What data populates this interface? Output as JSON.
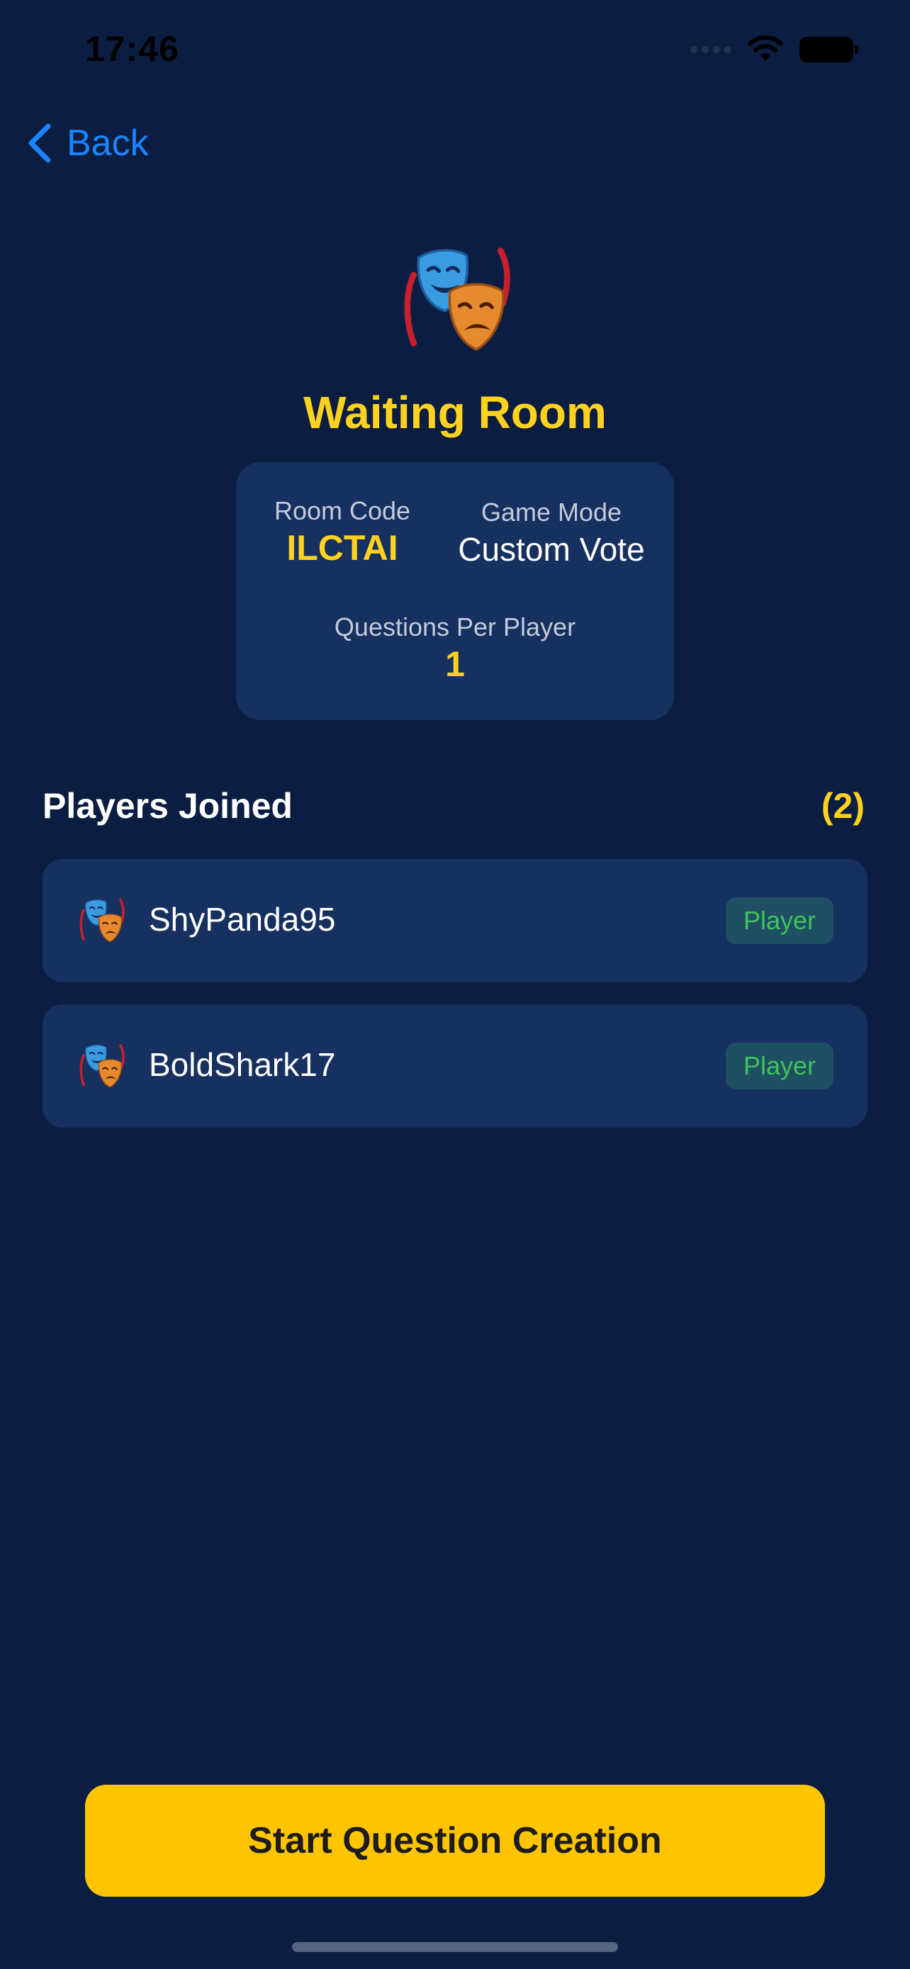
{
  "status_bar": {
    "time": "17:46"
  },
  "nav": {
    "back_label": "Back"
  },
  "header": {
    "title": "Waiting Room",
    "icon": "performing-arts-masks-icon"
  },
  "room_info": {
    "room_code_label": "Room Code",
    "room_code": "ILCTAI",
    "game_mode_label": "Game Mode",
    "game_mode": "Custom Vote",
    "questions_label": "Questions Per Player",
    "questions_per_player": "1"
  },
  "players": {
    "title": "Players Joined",
    "count": "(2)",
    "items": [
      {
        "name": "ShyPanda95",
        "role": "Player"
      },
      {
        "name": "BoldShark17",
        "role": "Player"
      }
    ]
  },
  "actions": {
    "start_label": "Start Question Creation"
  },
  "colors": {
    "background": "#0b1e42",
    "card": "#16305f",
    "accent_yellow": "#ffd21f",
    "button_yellow": "#ffc400",
    "link_blue": "#1a84ff",
    "badge_green": "#3ec45a"
  }
}
